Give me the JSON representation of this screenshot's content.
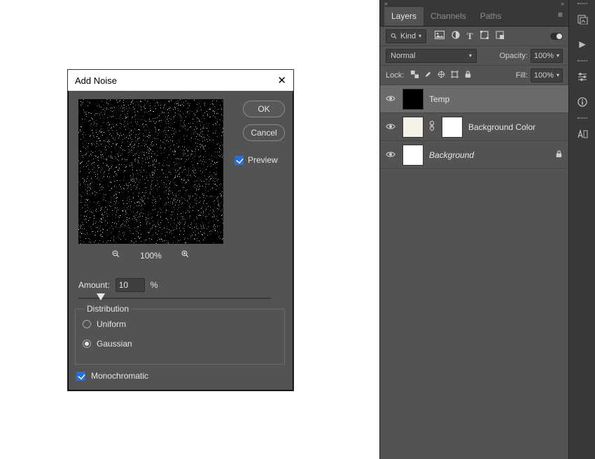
{
  "dialog": {
    "title": "Add Noise",
    "ok": "OK",
    "cancel": "Cancel",
    "preview_label": "Preview",
    "preview_checked": true,
    "zoom": "100%",
    "amount_label": "Amount:",
    "amount_value": "10",
    "amount_suffix": "%",
    "distribution_legend": "Distribution",
    "uniform": "Uniform",
    "gaussian": "Gaussian",
    "distribution_selected": "gaussian",
    "monochromatic": "Monochromatic",
    "monochromatic_checked": true
  },
  "panel": {
    "tabs": {
      "layers": "Layers",
      "channels": "Channels",
      "paths": "Paths"
    },
    "kind_label": "Kind",
    "blend_mode": "Normal",
    "opacity_label": "Opacity:",
    "opacity_value": "100%",
    "lock_label": "Lock:",
    "fill_label": "Fill:",
    "fill_value": "100%",
    "layers": [
      {
        "name": "Temp",
        "selected": true
      },
      {
        "name": "Background Color",
        "selected": false
      },
      {
        "name": "Background",
        "selected": false,
        "locked": true
      }
    ]
  }
}
